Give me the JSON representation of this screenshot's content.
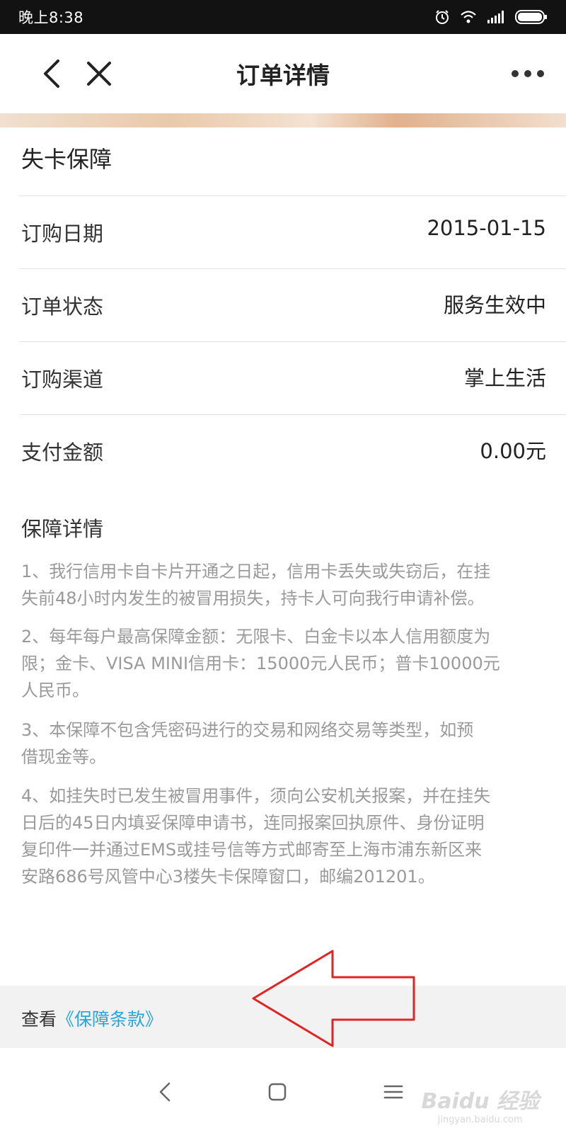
{
  "status_bar": {
    "time": "晚上8:38"
  },
  "header": {
    "title": "订单详情"
  },
  "card": {
    "title": "失卡保障"
  },
  "rows": [
    {
      "label": "订购日期",
      "value": "2015-01-15"
    },
    {
      "label": "订单状态",
      "value": "服务生效中"
    },
    {
      "label": "订购渠道",
      "value": "掌上生活"
    },
    {
      "label": "支付金额",
      "value": "0.00元"
    }
  ],
  "details": {
    "title": "保障详情",
    "p1_line1": "1、我行信用卡自卡片开通之日起，信用卡丢失或失窃后，在挂",
    "p1_line2": "失前48小时内发生的被冒用损失，持卡人可向我行申请补偿。",
    "p2_line1": "2、每年每户最高保障金额：无限卡、白金卡以本人信用额度为",
    "p2_line2": "限；金卡、VISA MINI信用卡：15000元人民币；普卡10000元",
    "p2_line3": "人民币。",
    "p3_line1": "3、本保障不包含凭密码进行的交易和网络交易等类型，如预",
    "p3_line2": "借现金等。",
    "p4_line1": "4、如挂失时已发生被冒用事件，须向公安机关报案，并在挂失",
    "p4_line2": "日后的45日内填妥保障申请书，连同报案回执原件、身份证明",
    "p4_line3": "复印件一并通过EMS或挂号信等方式邮寄至上海市浦东新区来",
    "p4_line4": "安路686号风管中心3楼失卡保障窗口，邮编201201。"
  },
  "footer": {
    "prefix": "查看",
    "link": "《保障条款》"
  },
  "watermark": {
    "main": "Baidu 经验",
    "sub": "jingyan.baidu.com"
  },
  "colors": {
    "link": "#2aa3d8",
    "annotation_arrow": "#e02424",
    "paragraph_text": "#9a9a9a"
  }
}
